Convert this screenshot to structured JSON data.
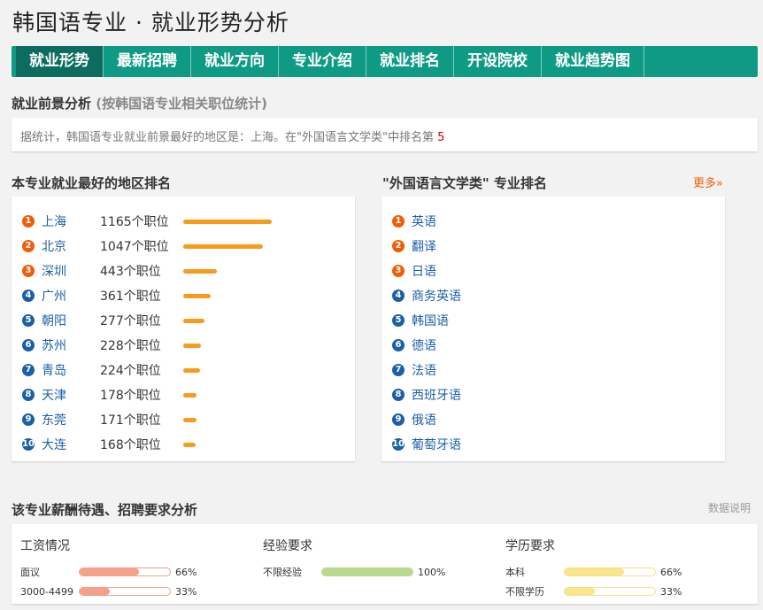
{
  "page": {
    "title": "韩国语专业 · 就业形势分析"
  },
  "nav": {
    "tabs": [
      {
        "label": "就业形势",
        "active": true
      },
      {
        "label": "最新招聘",
        "active": false
      },
      {
        "label": "就业方向",
        "active": false
      },
      {
        "label": "专业介绍",
        "active": false
      },
      {
        "label": "就业排名",
        "active": false
      },
      {
        "label": "开设院校",
        "active": false
      },
      {
        "label": "就业趋势图",
        "active": false
      }
    ]
  },
  "outlook": {
    "title": "就业前景分析",
    "subtitle": "(按韩国语专业相关职位统计)",
    "summary": "据统计，韩国语专业就业前景最好的地区是：上海。在\"外国语言文学类\"中排名第",
    "rank": "5"
  },
  "regions": {
    "title": "本专业就业最好的地区排名",
    "items": [
      {
        "rank": "1",
        "name": "上海",
        "count": "1165个职位",
        "jobs": 1165
      },
      {
        "rank": "2",
        "name": "北京",
        "count": "1047个职位",
        "jobs": 1047
      },
      {
        "rank": "3",
        "name": "深圳",
        "count": "443个职位",
        "jobs": 443
      },
      {
        "rank": "4",
        "name": "广州",
        "count": "361个职位",
        "jobs": 361
      },
      {
        "rank": "5",
        "name": "朝阳",
        "count": "277个职位",
        "jobs": 277
      },
      {
        "rank": "6",
        "name": "苏州",
        "count": "228个职位",
        "jobs": 228
      },
      {
        "rank": "7",
        "name": "青岛",
        "count": "224个职位",
        "jobs": 224
      },
      {
        "rank": "8",
        "name": "天津",
        "count": "178个职位",
        "jobs": 178
      },
      {
        "rank": "9",
        "name": "东莞",
        "count": "171个职位",
        "jobs": 171
      },
      {
        "rank": "10",
        "name": "大连",
        "count": "168个职位",
        "jobs": 168
      }
    ]
  },
  "majors": {
    "title": "\"外国语言文学类\" 专业排名",
    "more": "更多»",
    "items": [
      {
        "rank": "1",
        "name": "英语"
      },
      {
        "rank": "2",
        "name": "翻译"
      },
      {
        "rank": "3",
        "name": "日语"
      },
      {
        "rank": "4",
        "name": "商务英语"
      },
      {
        "rank": "5",
        "name": "韩国语"
      },
      {
        "rank": "6",
        "name": "德语"
      },
      {
        "rank": "7",
        "name": "法语"
      },
      {
        "rank": "8",
        "name": "西班牙语"
      },
      {
        "rank": "9",
        "name": "俄语"
      },
      {
        "rank": "10",
        "name": "葡萄牙语"
      }
    ]
  },
  "salary": {
    "title": "该专业薪酬待遇、招聘要求分析",
    "note": "数据说明",
    "columns": [
      {
        "heading": "工资情况",
        "bar_color": "#f4a08a",
        "border_color": "#f0a090",
        "rows": [
          {
            "label": "面议",
            "percent": 66,
            "pct_text": "66%"
          },
          {
            "label": "3000-4499",
            "percent": 33,
            "pct_text": "33%"
          }
        ]
      },
      {
        "heading": "经验要求",
        "bar_color": "#b9d98c",
        "border_color": "#b5d58a",
        "rows": [
          {
            "label": "不限经验",
            "percent": 100,
            "pct_text": "100%"
          }
        ]
      },
      {
        "heading": "学历要求",
        "bar_color": "#f8e58c",
        "border_color": "#f2df8a",
        "rows": [
          {
            "label": "本科",
            "percent": 66,
            "pct_text": "66%"
          },
          {
            "label": "不限学历",
            "percent": 33,
            "pct_text": "33%"
          }
        ]
      }
    ]
  }
}
